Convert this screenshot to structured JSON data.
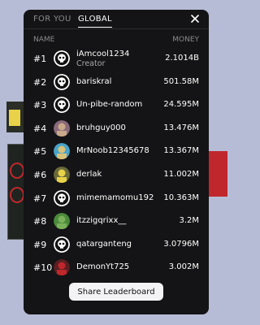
{
  "tabs": [
    {
      "label": "FOR YOU",
      "active": false
    },
    {
      "label": "GLOBAL",
      "active": true
    }
  ],
  "columns": {
    "name": "NAME",
    "money": "MONEY"
  },
  "rows": [
    {
      "rank": "#1",
      "name": "iAmcool1234",
      "role": "Creator",
      "money": "2.1014B",
      "avatar": "skull"
    },
    {
      "rank": "#2",
      "name": "bariskral",
      "money": "501.58M",
      "avatar": "skull"
    },
    {
      "rank": "#3",
      "name": "Un-pibe-random",
      "money": "24.595M",
      "avatar": "skull"
    },
    {
      "rank": "#4",
      "name": "bruhguy000",
      "money": "13.476M",
      "avatar": "photo-purple"
    },
    {
      "rank": "#5",
      "name": "MrNoob12345678",
      "money": "13.367M",
      "avatar": "photo-blue"
    },
    {
      "rank": "#6",
      "name": "derlak",
      "money": "11.002M",
      "avatar": "photo-yellow"
    },
    {
      "rank": "#7",
      "name": "mimemamomu192",
      "money": "10.363M",
      "avatar": "skull"
    },
    {
      "rank": "#8",
      "name": "itzzigqrixx__",
      "money": "3.2M",
      "avatar": "photo-green"
    },
    {
      "rank": "#9",
      "name": "qatarganteng",
      "money": "3.0796M",
      "avatar": "skull"
    },
    {
      "rank": "#10",
      "name": "DemonYt725",
      "money": "3.002M",
      "avatar": "photo-red"
    }
  ],
  "share_label": "Share Leaderboard",
  "colors": {
    "panel": "#141416",
    "background": "#b7bcd6",
    "muted": "#8a8a90"
  }
}
